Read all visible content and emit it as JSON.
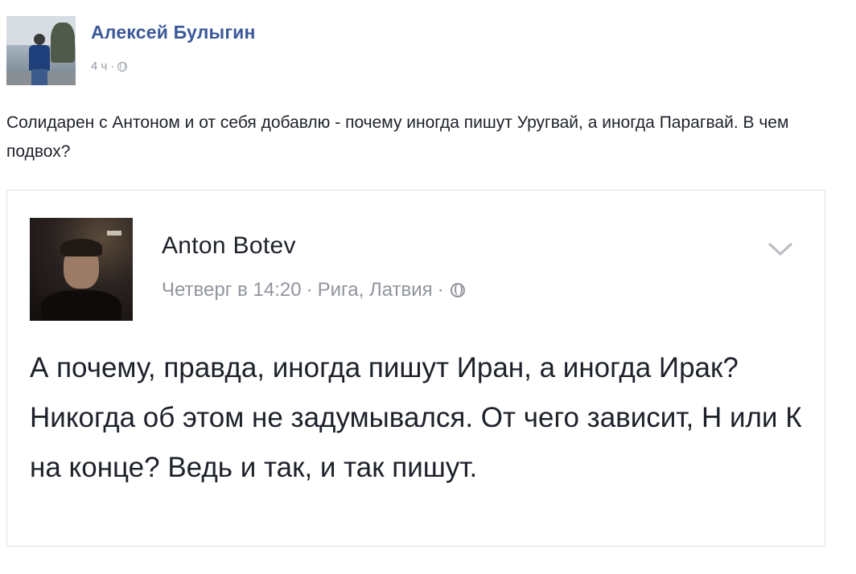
{
  "post": {
    "author": "Алексей Булыгин",
    "time": "4 ч",
    "separator": "·",
    "text": "Солидарен с Антоном и от себя добавлю - почему иногда пишут Уругвай, а иногда Парагвай. В чем подвох?",
    "privacy_icon": "globe-icon"
  },
  "shared": {
    "author": "Anton Botev",
    "time": "Четверг в 14:20",
    "separator": "·",
    "location": "Рига, Латвия",
    "separator2": "·",
    "privacy_icon": "globe-icon",
    "menu_icon": "chevron-down-icon",
    "text": "А почему, правда, иногда пишут Иран, а иногда Ирак? Никогда об этом не задумывался. От чего зависит, Н или К на конце? Ведь и так, и так пишут."
  },
  "colors": {
    "author_link": "#3b5998",
    "meta_gray": "#90949c",
    "text": "#1d2129",
    "border": "#dddfe2"
  }
}
